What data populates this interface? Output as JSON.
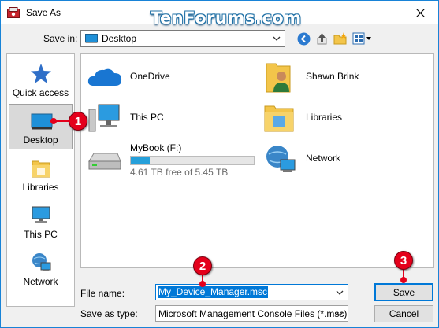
{
  "window": {
    "title": "Save As",
    "watermark": "TenForums.com"
  },
  "toolbar": {
    "save_in_label": "Save in:",
    "save_in_value": "Desktop",
    "buttons": [
      "back-icon",
      "up-folder-icon",
      "new-folder-icon",
      "view-menu-icon"
    ]
  },
  "places": [
    {
      "label": "Quick access",
      "icon": "star-icon",
      "selected": false
    },
    {
      "label": "Desktop",
      "icon": "desktop-icon",
      "selected": true
    },
    {
      "label": "Libraries",
      "icon": "libraries-icon",
      "selected": false
    },
    {
      "label": "This PC",
      "icon": "this-pc-icon",
      "selected": false
    },
    {
      "label": "Network",
      "icon": "network-icon",
      "selected": false
    }
  ],
  "files": [
    {
      "name": "OneDrive",
      "icon": "onedrive-icon"
    },
    {
      "name": "Shawn Brink",
      "icon": "user-folder-icon"
    },
    {
      "name": "This PC",
      "icon": "this-pc-icon"
    },
    {
      "name": "Libraries",
      "icon": "libraries-icon"
    },
    {
      "name": "MyBook (F:)",
      "icon": "drive-icon",
      "free_text": "4.61 TB free of 5.45 TB",
      "used_fraction": 0.154
    },
    {
      "name": "Network",
      "icon": "network-icon"
    }
  ],
  "form": {
    "file_name_label": "File name:",
    "file_name_value": "My_Device_Manager.msc",
    "save_as_type_label": "Save as type:",
    "save_as_type_value": "Microsoft Management Console Files (*.msc)",
    "save_button": "Save",
    "cancel_button": "Cancel"
  },
  "callouts": [
    "1",
    "2",
    "3"
  ],
  "colors": {
    "accent": "#0078d7",
    "callout": "#e4001b",
    "selection": "#d9d9d9"
  }
}
